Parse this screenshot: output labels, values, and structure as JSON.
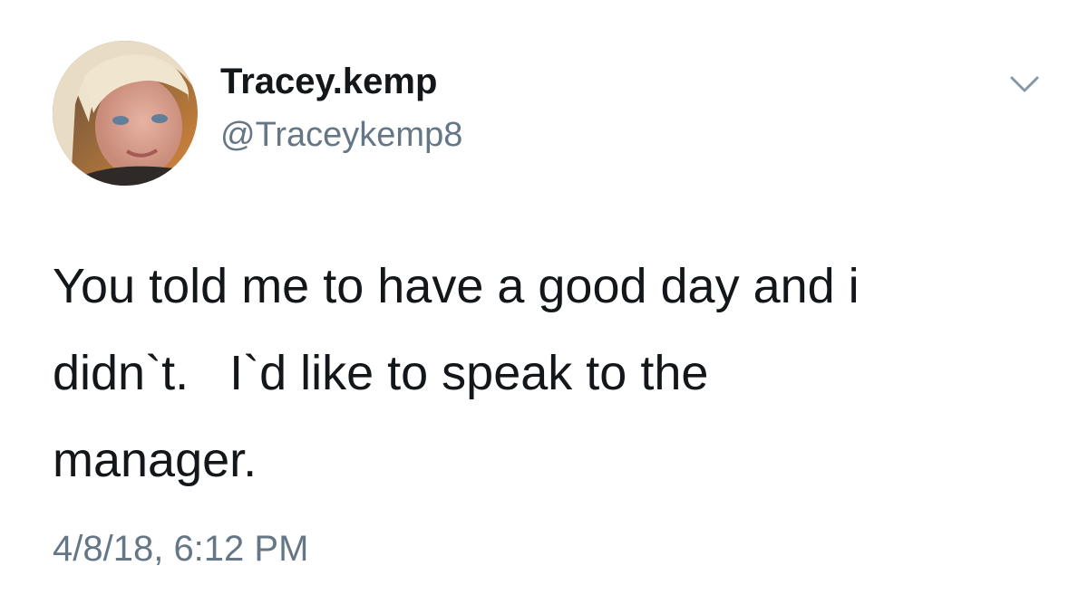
{
  "tweet": {
    "display_name": "Tracey.kemp",
    "handle": "@Traceykemp8",
    "text": "You told me to have a good day and i\ndidn`t.   I`d like to speak to the\nmanager.",
    "timestamp": "4/8/18, 6:12 PM"
  },
  "icons": {
    "avatar": "profile-photo",
    "menu": "chevron-down-icon"
  },
  "colors": {
    "primary_text": "#14171a",
    "secondary_text": "#657786",
    "background": "#ffffff"
  }
}
